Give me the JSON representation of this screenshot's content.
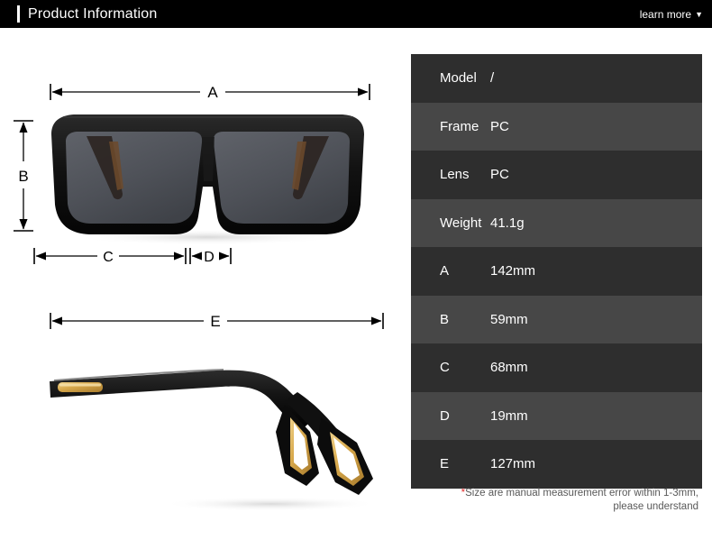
{
  "header": {
    "title": "Product Information",
    "learn_more_label": "learn more",
    "caret_icon": "chevron-down-icon",
    "background_color": "#000000",
    "text_color": "#ffffff",
    "accent_bar_color": "#ffffff"
  },
  "diagram": {
    "front_view_labels": {
      "a": "A",
      "b": "B",
      "c": "C",
      "d": "D"
    },
    "side_view_labels": {
      "e": "E"
    },
    "colors": {
      "frame": "#111111",
      "lens": "#53565c",
      "gold_accent": "#d4a348",
      "dimension_line": "#000000"
    }
  },
  "spec_table": {
    "rows": [
      {
        "label": "Model",
        "value": "/"
      },
      {
        "label": "Frame",
        "value": "PC"
      },
      {
        "label": "Lens",
        "value": "PC"
      },
      {
        "label": "Weight",
        "value": "41.1g"
      },
      {
        "label": "A",
        "value": "142mm"
      },
      {
        "label": "B",
        "value": "59mm"
      },
      {
        "label": "C",
        "value": "68mm"
      },
      {
        "label": "D",
        "value": "19mm"
      },
      {
        "label": "E",
        "value": "127mm"
      }
    ],
    "row_color_dark": "#2e2e2e",
    "row_color_light": "#474747"
  },
  "note": {
    "star": "*",
    "line1": "Size are manual measurement error within 1-3mm,",
    "line2": "please understand",
    "star_color": "#e02b2b",
    "text_color": "#595959"
  }
}
